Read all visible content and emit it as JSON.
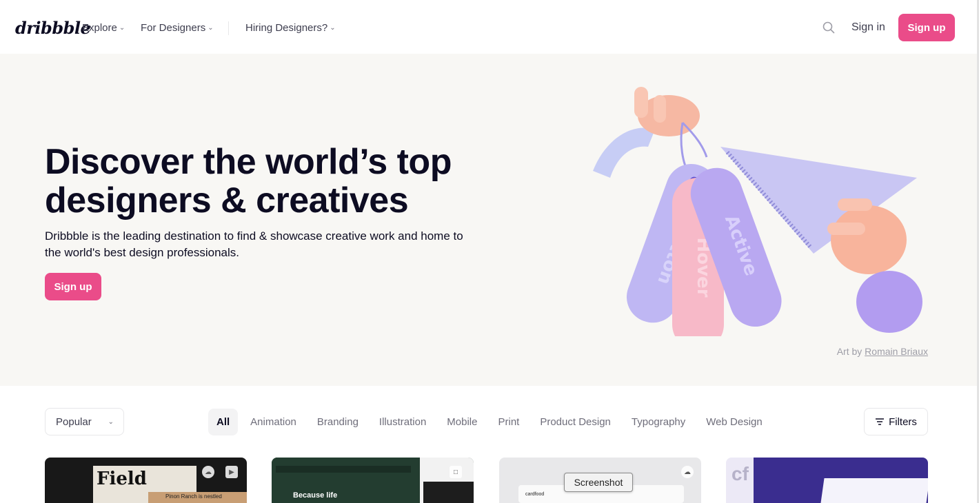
{
  "nav": {
    "logo": "dribbble",
    "explore": "Explore",
    "for_designers": "For Designers",
    "hiring": "Hiring Designers?",
    "sign_in": "Sign in",
    "sign_up": "Sign up"
  },
  "hero": {
    "title": "Discover the world’s top designers & creatives",
    "description": "Dribbble is the leading destination to find & showcase creative work and home to the world's best design professionals.",
    "cta": "Sign up",
    "art_by": "Art by",
    "artist": "Romain Briaux",
    "tags": [
      "Button",
      "Hover",
      "Active"
    ]
  },
  "filters": {
    "sort": "Popular",
    "categories": [
      "All",
      "Animation",
      "Branding",
      "Illustration",
      "Mobile",
      "Print",
      "Product Design",
      "Typography",
      "Web Design"
    ],
    "filters_label": "Filters"
  },
  "shots": {
    "shot1_text": "Field",
    "shot1_sub": "Pinon Ranch is nestled",
    "shot2_text": "Because life",
    "shot3_text": "cardfood",
    "tooltip": "Screenshot"
  },
  "colors": {
    "accent": "#ea4c89",
    "hero_bg": "#f8f7f4"
  }
}
